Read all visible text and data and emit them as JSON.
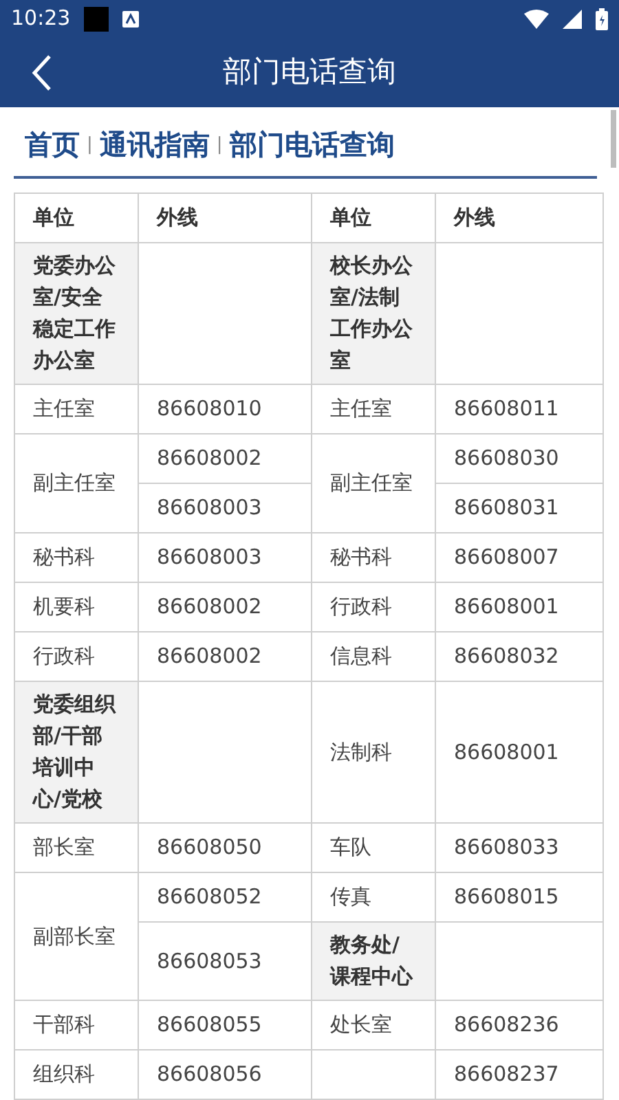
{
  "status_bar": {
    "time": "10:23"
  },
  "app_bar": {
    "title": "部门电话查询"
  },
  "breadcrumb": {
    "separator": "|",
    "items": [
      {
        "label": "首页"
      },
      {
        "label": "通讯指南"
      },
      {
        "label": "部门电话查询"
      }
    ]
  },
  "table": {
    "rows": [
      [
        {
          "kind": "header",
          "text": "单位"
        },
        {
          "kind": "header",
          "text": "外线"
        },
        {
          "kind": "header",
          "text": "单位"
        },
        {
          "kind": "header",
          "text": "外线"
        }
      ],
      [
        {
          "kind": "group",
          "text": "党委办公室/安全稳定工作办公室"
        },
        {
          "kind": "blank"
        },
        {
          "kind": "group",
          "text": "校长办公室/法制工作办公室"
        },
        {
          "kind": "blank"
        }
      ],
      [
        {
          "kind": "plain",
          "text": "主任室"
        },
        {
          "kind": "plain",
          "text": "86608010"
        },
        {
          "kind": "plain",
          "text": "主任室"
        },
        {
          "kind": "plain",
          "text": "86608011"
        }
      ],
      [
        {
          "kind": "plain",
          "text": "副主任室",
          "rowspan": 2
        },
        {
          "kind": "plain",
          "text": "86608002"
        },
        {
          "kind": "plain",
          "text": "副主任室",
          "rowspan": 2
        },
        {
          "kind": "plain",
          "text": "86608030"
        }
      ],
      [
        {
          "kind": "plain",
          "text": "86608003"
        },
        {
          "kind": "plain",
          "text": "86608031"
        }
      ],
      [
        {
          "kind": "plain",
          "text": "秘书科"
        },
        {
          "kind": "plain",
          "text": "86608003"
        },
        {
          "kind": "plain",
          "text": "秘书科"
        },
        {
          "kind": "plain",
          "text": "86608007"
        }
      ],
      [
        {
          "kind": "plain",
          "text": "机要科"
        },
        {
          "kind": "plain",
          "text": "86608002"
        },
        {
          "kind": "plain",
          "text": "行政科"
        },
        {
          "kind": "plain",
          "text": "86608001"
        }
      ],
      [
        {
          "kind": "plain",
          "text": "行政科"
        },
        {
          "kind": "plain",
          "text": "86608002"
        },
        {
          "kind": "plain",
          "text": "信息科"
        },
        {
          "kind": "plain",
          "text": "86608032"
        }
      ],
      [
        {
          "kind": "group",
          "text": "党委组织部/干部培训中心/党校"
        },
        {
          "kind": "blank"
        },
        {
          "kind": "plain",
          "text": "法制科"
        },
        {
          "kind": "plain",
          "text": "86608001"
        }
      ],
      [
        {
          "kind": "plain",
          "text": "部长室"
        },
        {
          "kind": "plain",
          "text": "86608050"
        },
        {
          "kind": "plain",
          "text": "车队"
        },
        {
          "kind": "plain",
          "text": "86608033"
        }
      ],
      [
        {
          "kind": "plain",
          "text": "副部长室",
          "rowspan": 2
        },
        {
          "kind": "plain",
          "text": "86608052"
        },
        {
          "kind": "plain",
          "text": "传真"
        },
        {
          "kind": "plain",
          "text": "86608015"
        }
      ],
      [
        {
          "kind": "plain",
          "text": "86608053"
        },
        {
          "kind": "group",
          "text": "教务处/课程中心"
        },
        {
          "kind": "blank"
        }
      ],
      [
        {
          "kind": "plain",
          "text": "干部科"
        },
        {
          "kind": "plain",
          "text": "86608055"
        },
        {
          "kind": "plain",
          "text": "处长室"
        },
        {
          "kind": "plain",
          "text": "86608236"
        }
      ],
      [
        {
          "kind": "plain",
          "text": "组织科"
        },
        {
          "kind": "plain",
          "text": "86608056"
        },
        {
          "kind": "blank"
        },
        {
          "kind": "plain",
          "text": "86608237"
        }
      ]
    ]
  }
}
